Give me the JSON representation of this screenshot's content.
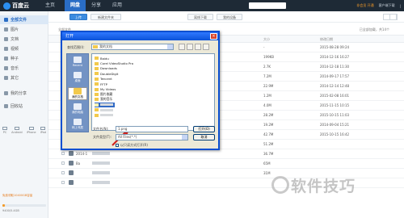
{
  "app": {
    "name": "百度云"
  },
  "nav": [
    "主页",
    "网盘",
    "分享",
    "应用"
  ],
  "top_right": {
    "vip": "非会员 开通",
    "user": "",
    "links": [
      "客户端下载",
      "|"
    ]
  },
  "sidebar": {
    "items": [
      "全部文件",
      "图片",
      "文档",
      "视频",
      "种子",
      "音乐",
      "其它",
      "我的分享",
      "回收站"
    ],
    "devices": [
      "PC",
      "Android",
      "iPhone",
      "iPad"
    ],
    "promo": "免费领取10400GB容量",
    "quota": {
      "used_fraction": 0.05,
      "text": "9400/5.4GB"
    }
  },
  "toolbar": {
    "upload": "上传",
    "new_folder": "新建文件夹",
    "offline": "离线下载",
    "my_device": "我的设备"
  },
  "crumbs": {
    "title": "全部文件",
    "count": "已全部加载，共14个"
  },
  "list_head": {
    "size": "大小",
    "date": "修改日期"
  },
  "files": [
    {
      "name": "",
      "size": "-",
      "date": "2015-08-28 09:24"
    },
    {
      "name": "",
      "size": "199KB",
      "date": "2014-12-16 16:27"
    },
    {
      "name": "",
      "size": "2.7K",
      "date": "2014-12-18 11:30"
    },
    {
      "name": "",
      "size": "7.2M",
      "date": "2014-09-17 17:57"
    },
    {
      "name": "",
      "size": "22.9M",
      "date": "2014-12-14 12:48"
    },
    {
      "name": "",
      "size": "1.2M",
      "date": "2015-02-08 16:01"
    },
    {
      "name": "",
      "size": "4.0M",
      "date": "2015-11-15 10:15"
    },
    {
      "name": "",
      "size": "28.2M",
      "date": "2015-10-15 11:03"
    },
    {
      "name": "",
      "size": "19.2M",
      "date": "2014-09-04 15:21"
    },
    {
      "name": "2014-10",
      "size": "42.7M",
      "date": "2015-10-15 16:42"
    },
    {
      "name": "2014-12-9-4.mp4",
      "size": "51.2M",
      "date": ""
    },
    {
      "name": "2014-1",
      "size": "36.7M",
      "date": ""
    },
    {
      "name": "Ba",
      "size": "65M",
      "date": ""
    },
    {
      "name": "",
      "size": "31M",
      "date": ""
    },
    {
      "name": "",
      "size": "",
      "date": ""
    }
  ],
  "dialog": {
    "title": "打开",
    "look_in_label": "查找范围(I):",
    "look_in_value": "我的文档",
    "places": [
      "Recent",
      "桌面",
      "我的文档",
      "我的电脑",
      "网上邻居"
    ],
    "items": [
      "Baidu",
      "Corel VideoStudio Pro",
      "Downloads",
      "DoubleDigit",
      "Tencent",
      "FFTP",
      "My Videos",
      "图片收藏",
      "我的音乐",
      "",
      "",
      ""
    ],
    "filename_label": "文件名(N):",
    "filename_value": "1.png",
    "filetype_label": "文件类型(T):",
    "filetype_value": "All Files(*.*)",
    "open_btn": "打开(O)",
    "cancel_btn": "取消",
    "readonly_label": "以只读方式打开(R)"
  },
  "watermark": "软件技巧"
}
